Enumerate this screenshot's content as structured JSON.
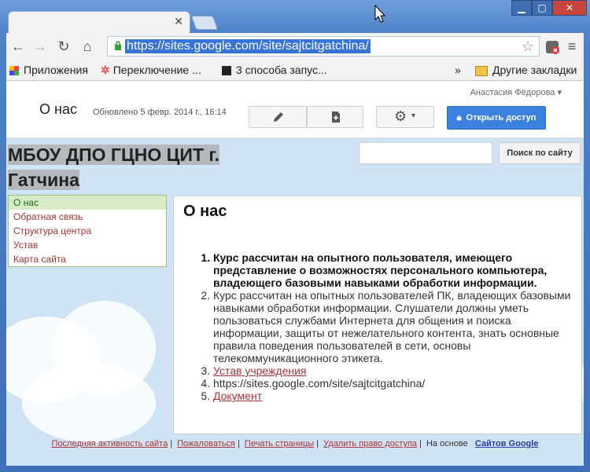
{
  "browser": {
    "url": "https://sites.google.com/site/sajtcitgatchina/",
    "bookmarks": [
      {
        "label": "Приложения",
        "icon": "apps-grid-icon"
      },
      {
        "label": "Переключение ...",
        "icon": "joomla-icon"
      },
      {
        "label": "3 способа запус...",
        "icon": "page-icon"
      },
      {
        "label": "Другие закладки",
        "icon": "folder-icon"
      }
    ],
    "overflow_label": "»"
  },
  "gbar": {
    "user": "Анастасия Фёдорова",
    "page_heading": "О нас",
    "updated": "Обновлено 5 февр. 2014 г., 16:14",
    "share_label": "Открыть доступ"
  },
  "site": {
    "title": "МБОУ ДПО ГЦНО ЦИТ г. Гатчина",
    "search_button": "Поиск по сайту",
    "search_value": ""
  },
  "sidenav": [
    {
      "label": "О нас",
      "active": true
    },
    {
      "label": "Обратная связь",
      "active": false
    },
    {
      "label": "Структура центра",
      "active": false
    },
    {
      "label": "Устав",
      "active": false
    },
    {
      "label": "Карта сайта",
      "active": false
    }
  ],
  "main": {
    "heading": "О нас",
    "items": [
      "Курс рассчитан на опытного пользователя, имеющего представление о возможностях персонального компьютера, владеющего базовыми навыками обработки информации.",
      "Курс рассчитан на опытных пользователей ПК, владеющих базовыми навыками обработки информации. Слушатели должны уметь пользоваться службами Интернета для общения и поиска информации, защиты от нежелательного контента, знать основные правила поведения пользователей в сети, основы телекоммуникационного этикета.",
      "Устав учреждения",
      "https://sites.google.com/site/sajtcitgatchina/",
      "Документ"
    ]
  },
  "footer": {
    "recent": "Последняя активность сайта",
    "report": "Пожаловаться",
    "print": "Печать страницы",
    "remove": "Удалить право доступа",
    "powered": "На основе",
    "brand": "Сайтов Google"
  }
}
